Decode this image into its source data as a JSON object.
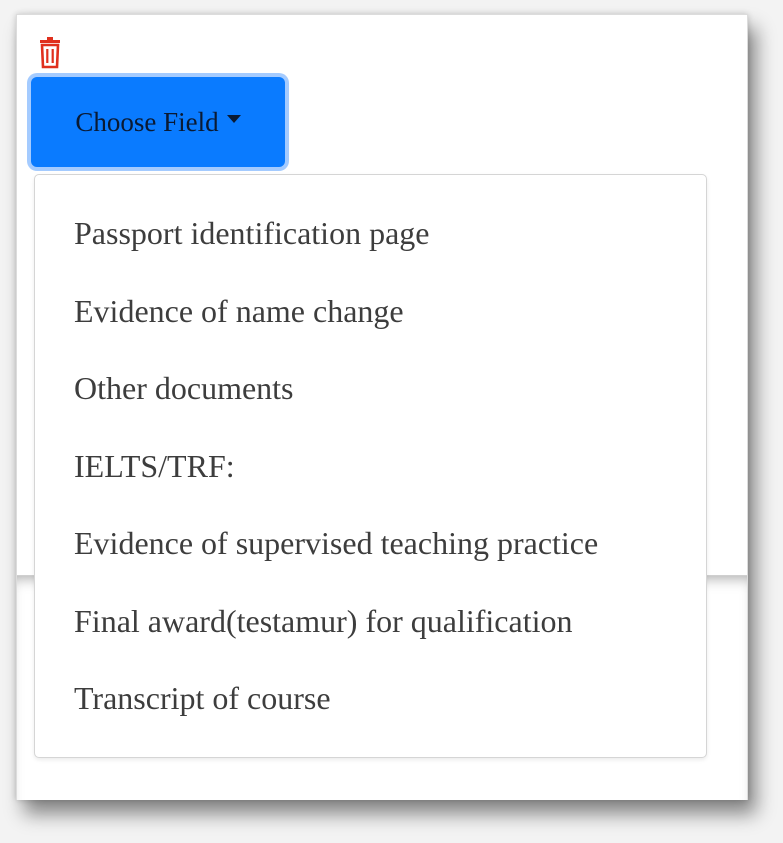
{
  "toolbar": {
    "delete_icon": "trash-icon",
    "delete_color": "#e0301e"
  },
  "dropdown": {
    "button_label": "Choose Field",
    "button_color": "#0a7bff",
    "items": [
      {
        "label": "Passport identification page"
      },
      {
        "label": "Evidence of name change"
      },
      {
        "label": "Other documents"
      },
      {
        "label": "IELTS/TRF:"
      },
      {
        "label": "Evidence of supervised teaching practice"
      },
      {
        "label": "Final award(testamur) for qualification"
      },
      {
        "label": "Transcript of course"
      }
    ]
  }
}
